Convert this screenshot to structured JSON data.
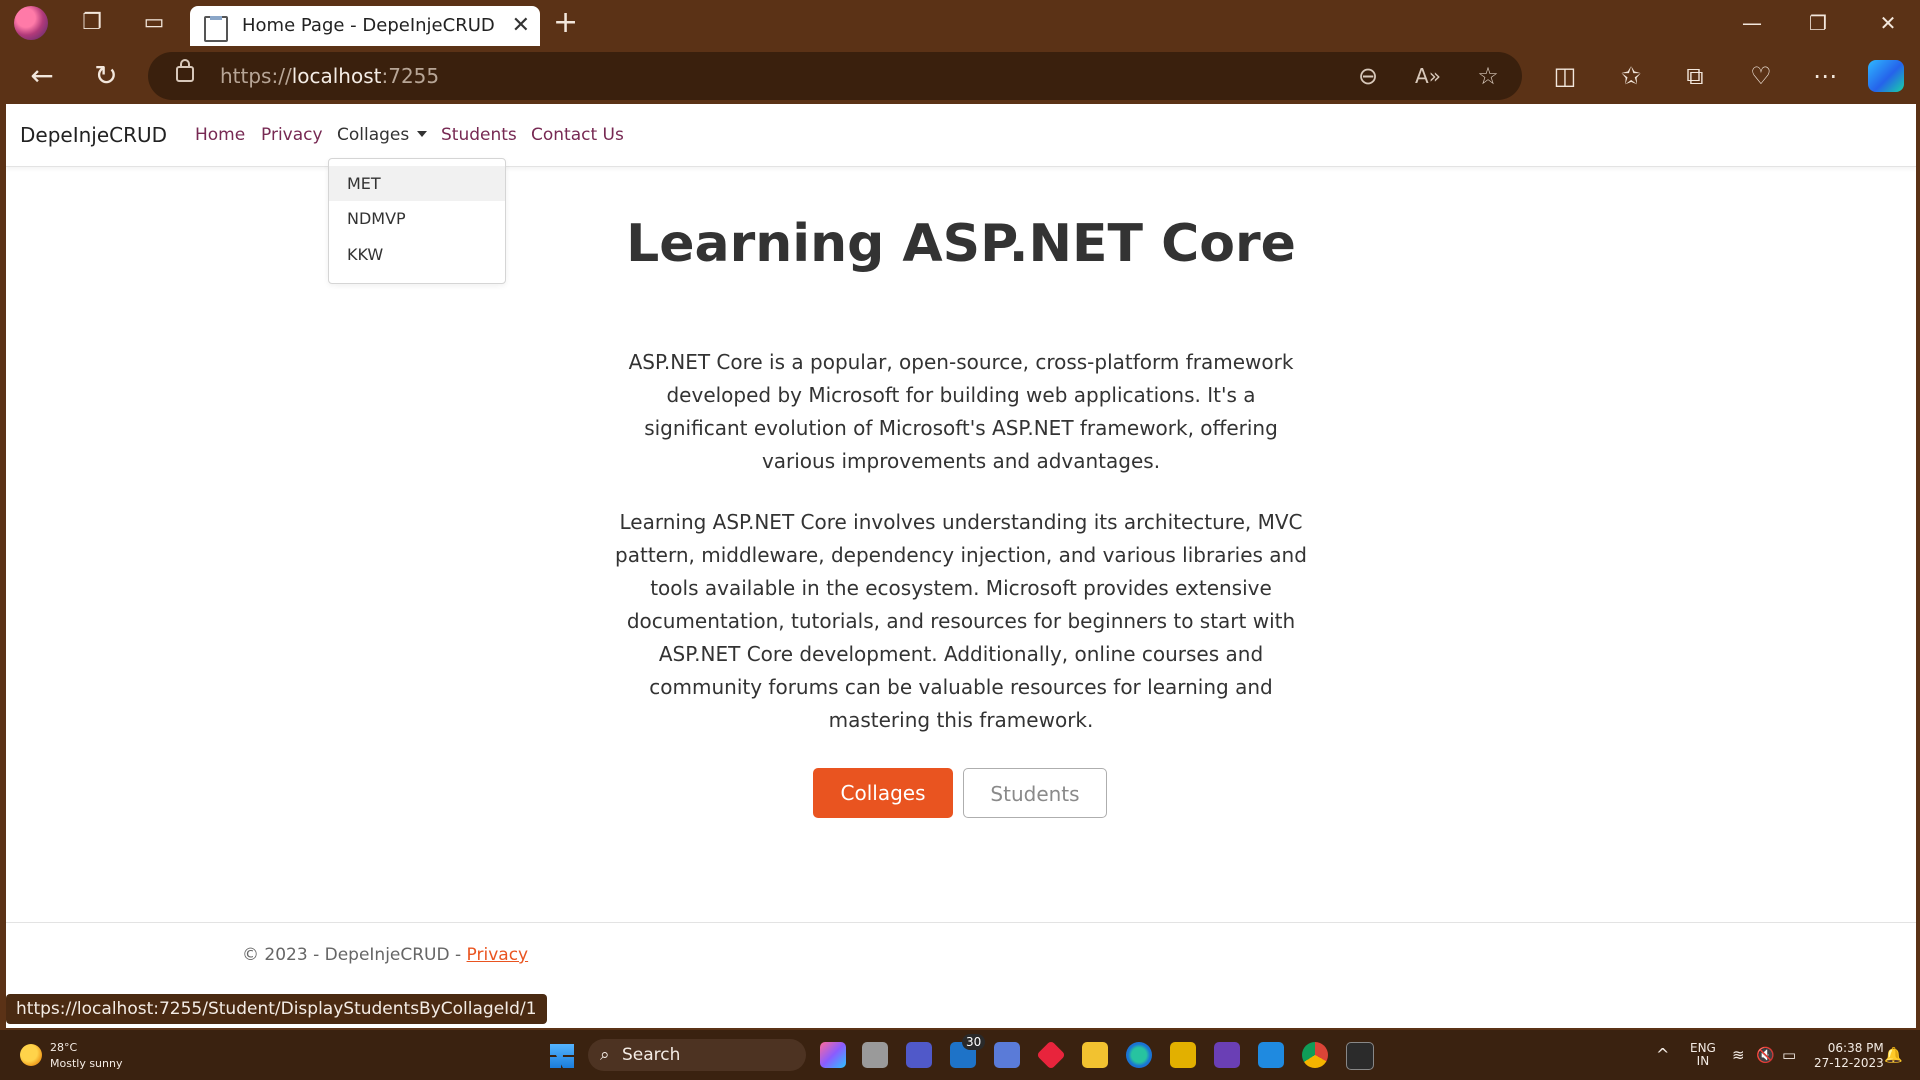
{
  "browser": {
    "tab_title": "Home Page - DepeInjeCRUD",
    "url_scheme": "https://",
    "url_host": "localhost",
    "url_port": ":7255",
    "status_url": "https://localhost:7255/Student/DisplayStudentsByCollageId/1"
  },
  "site": {
    "brand": "DepeInjeCRUD",
    "nav": {
      "home": "Home",
      "privacy": "Privacy",
      "collages": "Collages",
      "students": "Students",
      "contact": "Contact Us"
    },
    "dropdown": [
      "MET",
      "NDMVP",
      "KKW"
    ]
  },
  "main": {
    "title": "Learning ASP.NET Core",
    "para1": "ASP.NET Core is a popular, open-source, cross-platform framework developed by Microsoft for building web applications. It's a significant evolution of Microsoft's ASP.NET framework, offering various improvements and advantages.",
    "para2": "Learning ASP.NET Core involves understanding its architecture, MVC pattern, middleware, dependency injection, and various libraries and tools available in the ecosystem. Microsoft provides extensive documentation, tutorials, and resources for beginners to start with ASP.NET Core development. Additionally, online courses and community forums can be valuable resources for learning and mastering this framework.",
    "btn_collages": "Collages",
    "btn_students": "Students"
  },
  "footer": {
    "copyright": "© 2023 - DepeInjeCRUD - ",
    "privacy": "Privacy"
  },
  "taskbar": {
    "temp": "28°C",
    "weather": "Mostly sunny",
    "search": "Search",
    "mail_badge": "30",
    "lang1": "ENG",
    "lang2": "IN",
    "time": "06:38 PM",
    "date": "27-12-2023"
  },
  "colors": {
    "accent": "#e95420",
    "nav_link": "#772953",
    "chrome": "#5b3216"
  }
}
